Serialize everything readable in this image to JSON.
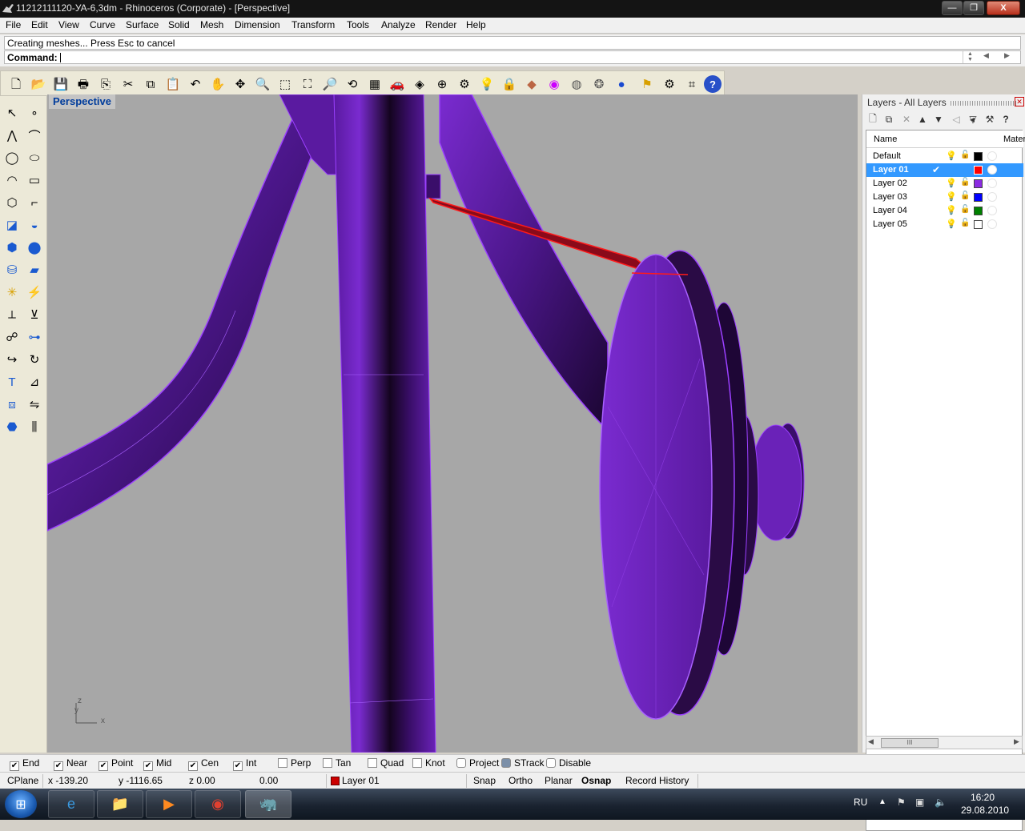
{
  "window": {
    "title": "11212111120-УА-6,3dm - Rhinoceros (Corporate) - [Perspective]",
    "btn_minimize": "—",
    "btn_restore": "❐",
    "btn_close": "X"
  },
  "menu": [
    "File",
    "Edit",
    "View",
    "Curve",
    "Surface",
    "Solid",
    "Mesh",
    "Dimension",
    "Transform",
    "Tools",
    "Analyze",
    "Render",
    "Help"
  ],
  "command": {
    "history": "Creating meshes... Press Esc to cancel",
    "prompt_label": "Command:"
  },
  "viewport": {
    "label": "Perspective",
    "axis_z": "z",
    "axis_y": "y",
    "axis_x": "x"
  },
  "layers_panel": {
    "title": "Layers - All Layers",
    "columns": {
      "name": "Name",
      "material": "Mater"
    },
    "rows": [
      {
        "name": "Default",
        "color": "#000000",
        "current": false
      },
      {
        "name": "Layer 01",
        "color": "#ff0000",
        "current": true
      },
      {
        "name": "Layer 02",
        "color": "#8b2be2",
        "current": false
      },
      {
        "name": "Layer 03",
        "color": "#0000ff",
        "current": false
      },
      {
        "name": "Layer 04",
        "color": "#008000",
        "current": false
      },
      {
        "name": "Layer 05",
        "color": "#ffffff",
        "current": false
      }
    ],
    "scroll_thumb": "III"
  },
  "osnap": {
    "items": [
      {
        "label": "End",
        "checked": true
      },
      {
        "label": "Near",
        "checked": true
      },
      {
        "label": "Point",
        "checked": true
      },
      {
        "label": "Mid",
        "checked": true
      },
      {
        "label": "Cen",
        "checked": true
      },
      {
        "label": "Int",
        "checked": true
      },
      {
        "label": "Perp",
        "checked": false
      },
      {
        "label": "Tan",
        "checked": false
      },
      {
        "label": "Quad",
        "checked": false
      },
      {
        "label": "Knot",
        "checked": false
      },
      {
        "label": "Project",
        "checked": false
      },
      {
        "label": "STrack",
        "checked": true
      },
      {
        "label": "Disable",
        "checked": false
      }
    ]
  },
  "status": {
    "cplane": "CPlane",
    "x": "x -139.20",
    "y": "y -1116.65",
    "z": "z 0.00",
    "extra": "0.00",
    "layer": "Layer 01",
    "layer_color": "#cc0000",
    "snap": "Snap",
    "ortho": "Ortho",
    "planar": "Planar",
    "osnap": "Osnap",
    "record_history": "Record History"
  },
  "taskbar": {
    "lang": "RU",
    "time": "16:20",
    "date": "29.08.2010"
  },
  "colors": {
    "object": "#7a2bd0",
    "object_dark": "#2a0b45",
    "highlight": "#ff0000",
    "selection": "#3399ff"
  }
}
